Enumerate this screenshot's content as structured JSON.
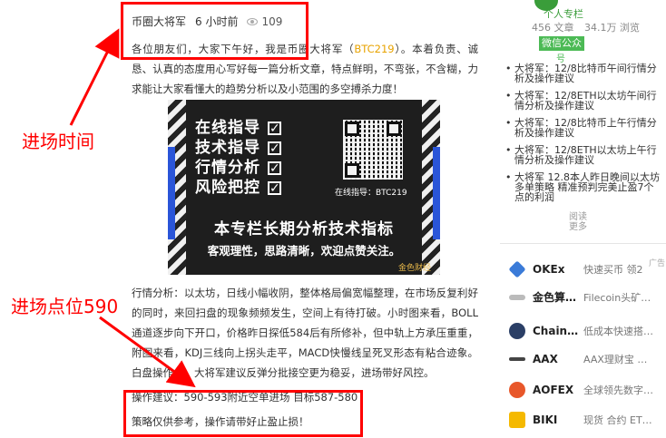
{
  "article": {
    "author": "币圈大将军",
    "time": "6 小时前",
    "views": "109",
    "intro_prefix": "各位朋友们，大家下午好，我是币圈大将军（",
    "intro_tag": "BTC219",
    "intro_suffix": "）。本着负责、诚恳、认真的态度用心写好每一篇分析文章，特点鲜明，不弯张，不含糊，力求能让大家看懂大的趋势分析以及小范围的多空搏杀力度！",
    "analysis": "行情分析：以太坊，日线小幅收阴，整体格局偏宽幅整理，在市场反复利好的同时，来回扫盘的现象频频发生，空间上有待打破。小时图来看，BOLL通道逐步向下开口，价格昨日探低584后有所修补，但中轨上方承压重重，附图来看，KDJ三线向上拐头走平，MACD快慢线呈死叉形态有粘合迹象。白盘操作上，大将军建议反弹分批接空更为稳妥，进场带好风控。",
    "operation": "操作建议：590-593附近空单进场 目标587-580",
    "note": "策略仅供参考，操作请带好止盈止损！"
  },
  "banner": {
    "items": [
      "在线指导",
      "技术指导",
      "行情分析",
      "风险把控"
    ],
    "qr_label": "在线指导：BTC219",
    "headline": "本专栏长期分析技术指标",
    "subline": "客观理性，思路清晰，欢迎点赞关注。",
    "brand": "金色财经"
  },
  "sidebar": {
    "author": "币圈大将军",
    "column_tag": "个人专栏",
    "stats": [
      "456 文章",
      "34.1万 浏览"
    ],
    "wechat": "微信公众",
    "wechat2": "号",
    "news": [
      "大将军：12/8比特币午间行情分析及操作建议",
      "大将军：12/8ETH以太坊午间行情分析及操作建议",
      "大将军：12/8比特币上午行情分析及操作建议",
      "大将军：12/8ETH以太坊上午行情分析及操作建议",
      "大将军 12.8本人昨日晚间以太坊多单策略 精准预判完美止盈7个点的利润"
    ],
    "more_1": "阅读",
    "more_2": "更多",
    "ad_label": "广告",
    "exchanges": [
      {
        "name": "OKEx",
        "desc": "快速买币 领2",
        "color": "#3b7bd8"
      },
      {
        "name": "金色算…",
        "desc": "Filecoin头矿…",
        "color": "#888888"
      },
      {
        "name": "Chain…",
        "desc": "低成本快速搭…",
        "color": "#2b3f66"
      },
      {
        "name": "AAX",
        "desc": "AAX理财宝 …",
        "color": "#444444"
      },
      {
        "name": "AOFEX",
        "desc": "全球领先数字…",
        "color": "#e8572a"
      },
      {
        "name": "BIKI",
        "desc": "现货 合约 ET…",
        "color": "#f5b900"
      }
    ]
  },
  "annotations": {
    "label_1": "进场时间",
    "label_2": "进场点位590",
    "color": "#ff0000"
  }
}
